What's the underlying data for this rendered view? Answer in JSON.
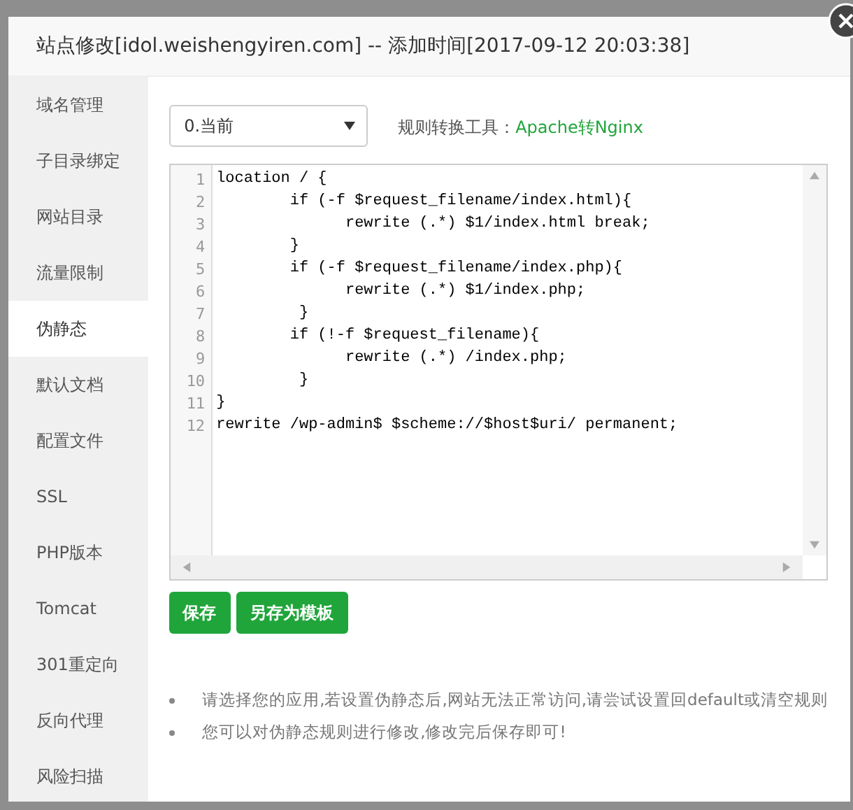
{
  "dialog": {
    "title": "站点修改[idol.weishengyiren.com] -- 添加时间[2017-09-12 20:03:38]"
  },
  "sidebar": {
    "items": [
      {
        "label": "域名管理",
        "selected": false
      },
      {
        "label": "子目录绑定",
        "selected": false
      },
      {
        "label": "网站目录",
        "selected": false
      },
      {
        "label": "流量限制",
        "selected": false
      },
      {
        "label": "伪静态",
        "selected": true
      },
      {
        "label": "默认文档",
        "selected": false
      },
      {
        "label": "配置文件",
        "selected": false
      },
      {
        "label": "SSL",
        "selected": false
      },
      {
        "label": "PHP版本",
        "selected": false
      },
      {
        "label": "Tomcat",
        "selected": false
      },
      {
        "label": "301重定向",
        "selected": false
      },
      {
        "label": "反向代理",
        "selected": false
      },
      {
        "label": "风险扫描",
        "selected": false
      }
    ]
  },
  "template_select": {
    "value": "0.当前"
  },
  "converter": {
    "label": "规则转换工具：",
    "link": "Apache转Nginx"
  },
  "editor": {
    "lines": [
      {
        "number": "1",
        "text": "location / {"
      },
      {
        "number": "2",
        "text": "        if (-f $request_filename/index.html){"
      },
      {
        "number": "3",
        "text": "              rewrite (.*) $1/index.html break;"
      },
      {
        "number": "4",
        "text": "        }"
      },
      {
        "number": "5",
        "text": "        if (-f $request_filename/index.php){"
      },
      {
        "number": "6",
        "text": "              rewrite (.*) $1/index.php;"
      },
      {
        "number": "7",
        "text": "         }"
      },
      {
        "number": "8",
        "text": "        if (!-f $request_filename){"
      },
      {
        "number": "9",
        "text": "              rewrite (.*) /index.php;"
      },
      {
        "number": "10",
        "text": "         }"
      },
      {
        "number": "11",
        "text": "}"
      },
      {
        "number": "12",
        "text": "rewrite /wp-admin$ $scheme://$host$uri/ permanent;"
      }
    ]
  },
  "buttons": [
    "保存",
    "另存为模板"
  ],
  "notes": [
    "请选择您的应用,若设置伪静态后,网站无法正常访问,请尝试设置回default或清空规则",
    "您可以对伪静态规则进行修改,修改完后保存即可!"
  ]
}
